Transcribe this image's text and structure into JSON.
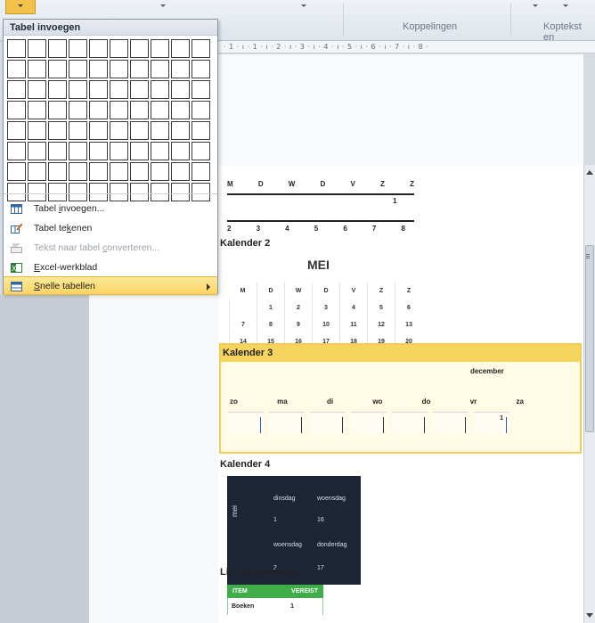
{
  "ribbon": {
    "group_links": "Koppelingen",
    "group_header": "Koptekst en"
  },
  "ruler": {
    "text": "· 1 · ı · 1 · ı · 2 · ı · 3 · ı · 4 · ı · 5 · ı · 6 · ı · 7 · ı · 8 ·"
  },
  "panel": {
    "title": "Tabel invoegen",
    "grid_cols": 10,
    "grid_rows": 8,
    "menu": [
      {
        "label_pre": "Tabel ",
        "label_ul": "i",
        "label_post": "nvoegen...",
        "icon": "table-insert-icon",
        "enabled": true
      },
      {
        "label_pre": "Tabel te",
        "label_ul": "k",
        "label_post": "enen",
        "icon": "table-draw-icon",
        "enabled": true
      },
      {
        "label_pre": "Tekst naar tabel ",
        "label_ul": "c",
        "label_post": "onverteren...",
        "icon": "text-to-table-icon",
        "enabled": false
      },
      {
        "label_pre": "",
        "label_ul": "E",
        "label_post": "xcel-werkblad",
        "icon": "excel-sheet-icon",
        "enabled": true
      },
      {
        "label_pre": "",
        "label_ul": "S",
        "label_post": "nelle tabellen",
        "icon": "quick-tables-icon",
        "enabled": true,
        "active": true,
        "submenu": true
      }
    ]
  },
  "document": {
    "k1": {
      "days": [
        "M",
        "D",
        "W",
        "D",
        "V",
        "Z",
        "Z"
      ],
      "first": "1",
      "nums": [
        "2",
        "3",
        "4",
        "5",
        "6",
        "7",
        "8"
      ]
    },
    "k2": {
      "heading": "Kalender 2",
      "month": "MEI",
      "days": [
        "M",
        "D",
        "W",
        "D",
        "V",
        "Z",
        "Z"
      ],
      "rows": [
        [
          "",
          "1",
          "2",
          "3",
          "4",
          "5",
          "6"
        ],
        [
          "7",
          "8",
          "9",
          "10",
          "11",
          "12",
          "13"
        ],
        [
          "14",
          "15",
          "16",
          "17",
          "18",
          "19",
          "20"
        ]
      ]
    },
    "k3": {
      "heading": "Kalender 3",
      "month": "december",
      "days": [
        "zo",
        "ma",
        "di",
        "wo",
        "do",
        "vr",
        "za"
      ],
      "first_day_num": "1"
    },
    "k4": {
      "heading": "Kalender 4",
      "month": "mei",
      "labels": [
        "dinsdag",
        "woensdag",
        "1",
        "16",
        "woensdag",
        "donderdag",
        "2",
        "17"
      ]
    },
    "list": {
      "heading": "Lijst in tabelvorm",
      "col1": "ITEM",
      "col2": "VEREIST",
      "row1_item": "Boeken",
      "row1_value": "1"
    }
  },
  "colors": {
    "accent_highlight": "#f9d461",
    "k4_bg": "#1d2637",
    "list_header": "#3fae49"
  }
}
